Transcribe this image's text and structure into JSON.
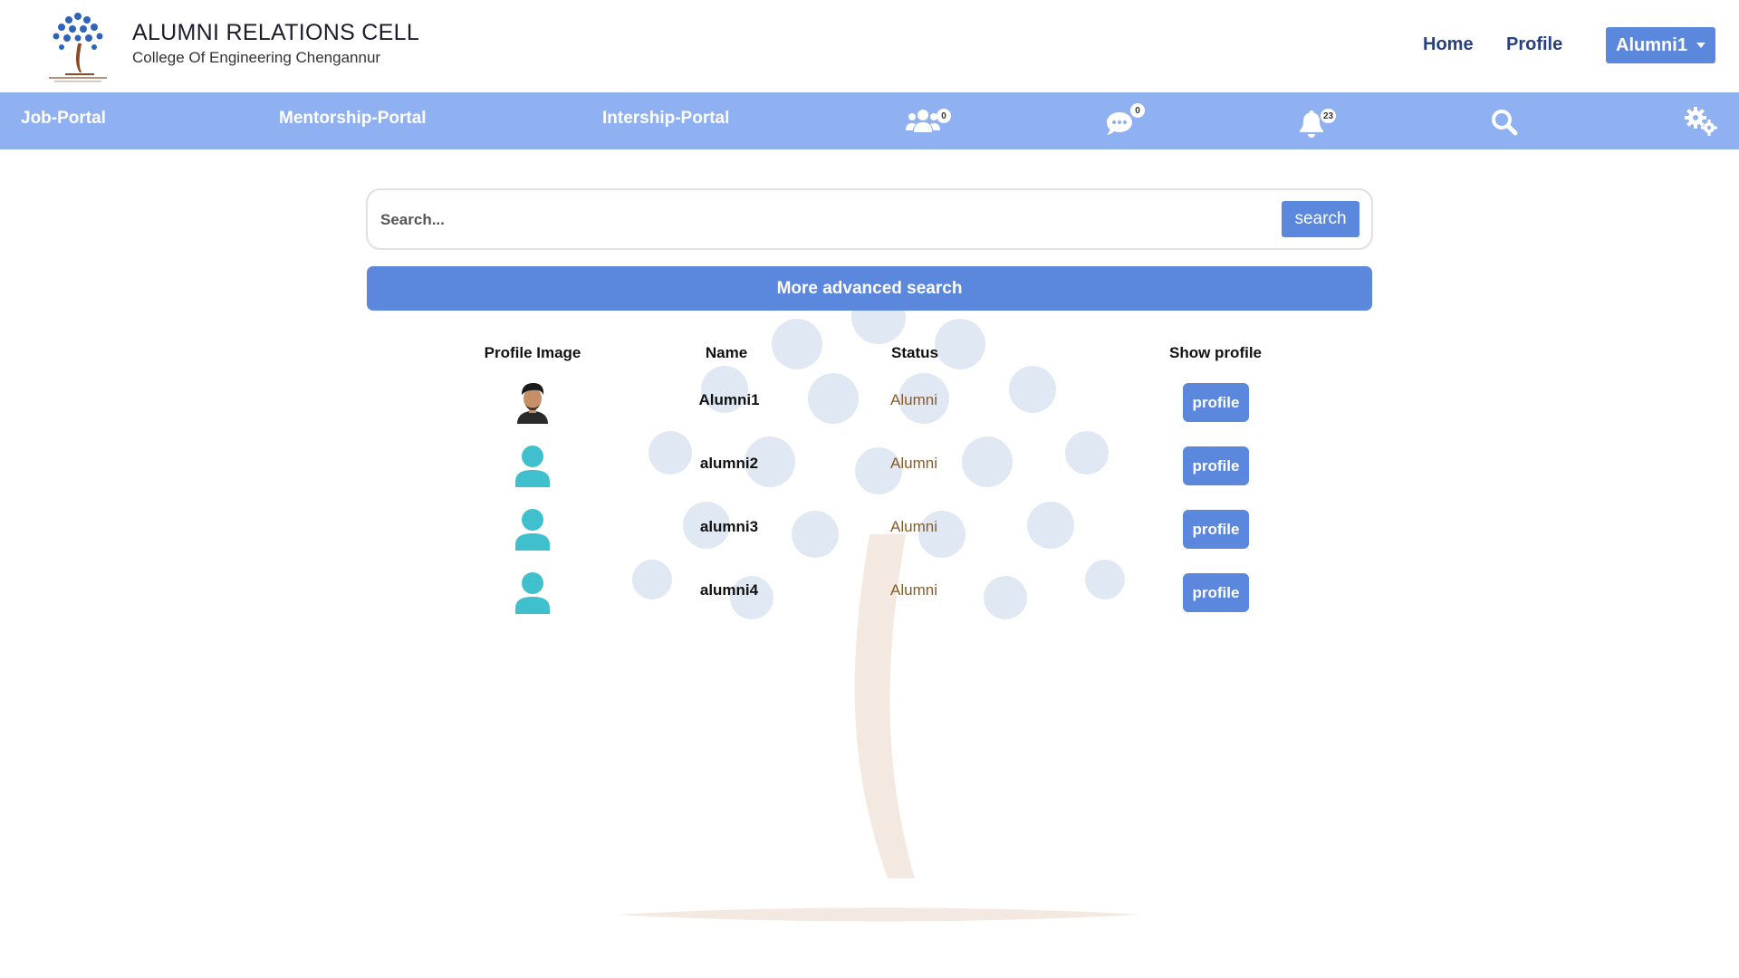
{
  "brand": {
    "title": "ALUMNI RELATIONS CELL",
    "subtitle": "College Of Engineering Chengannur",
    "logo_text": "ALUMNI RELATIONS CELL"
  },
  "top_nav": {
    "home": "Home",
    "profile": "Profile",
    "user": "Alumni1"
  },
  "navbar": {
    "job_portal": "Job-Portal",
    "mentorship_portal": "Mentorship-Portal",
    "internship_portal": "Intership-Portal",
    "friends_icon": "users-icon",
    "friends_count": "0",
    "messages_icon": "comment-icon",
    "messages_count": "0",
    "notifications_icon": "bell-icon",
    "notifications_count": "23",
    "search_icon": "search-icon",
    "settings_icon": "gears-icon"
  },
  "search": {
    "placeholder": "Search...",
    "button": "search",
    "advanced": "More advanced search"
  },
  "table": {
    "headers": [
      "Profile Image",
      "Name",
      "Status",
      "Show profile"
    ],
    "rows": [
      {
        "name": "Alumni1",
        "status": "Alumni",
        "button": "profile",
        "avatar": "photo"
      },
      {
        "name": "alumni2",
        "status": "Alumni",
        "button": "profile",
        "avatar": "default-user-icon"
      },
      {
        "name": "alumni3",
        "status": "Alumni",
        "button": "profile",
        "avatar": "default-user-icon"
      },
      {
        "name": "alumni4",
        "status": "Alumni",
        "button": "profile",
        "avatar": "default-user-icon"
      }
    ]
  },
  "colors": {
    "primary": "#5b87dd",
    "navbar": "#8fb0f1",
    "link": "#27407f",
    "status": "#8a5a25",
    "avatar_default": "#3fc0cc"
  }
}
